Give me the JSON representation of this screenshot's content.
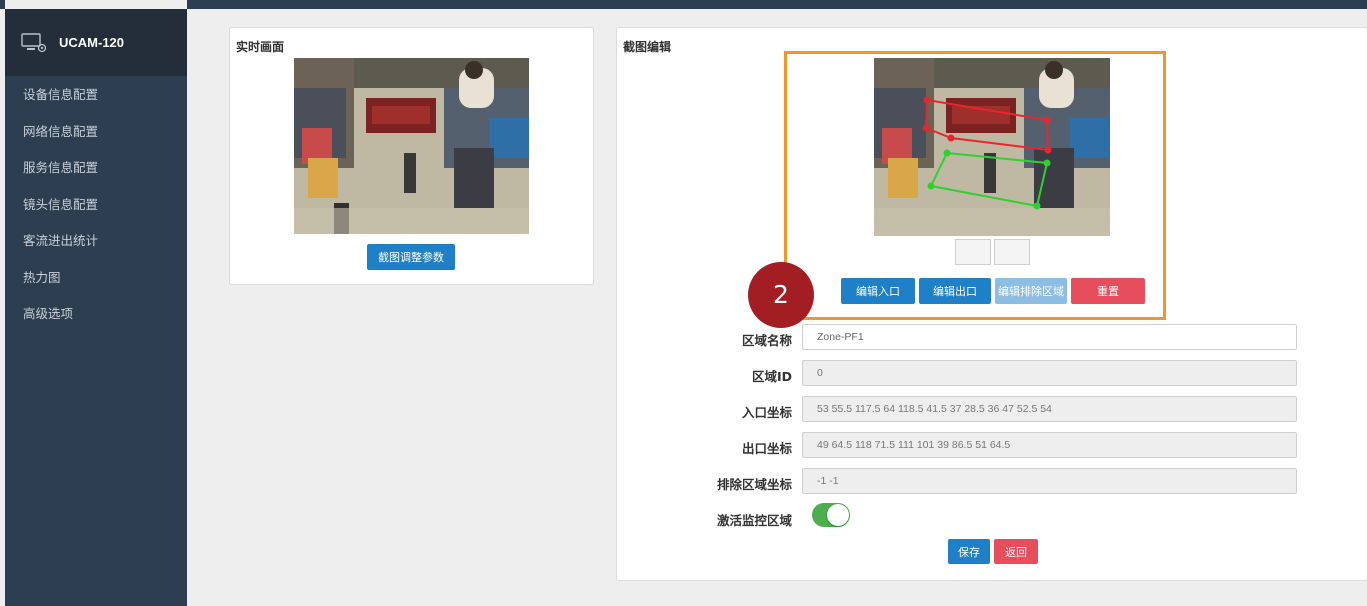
{
  "app": {
    "name": "UCAM-120"
  },
  "sidebar": {
    "items": [
      {
        "label": "设备信息配置"
      },
      {
        "label": "网络信息配置"
      },
      {
        "label": "服务信息配置"
      },
      {
        "label": "镜头信息配置"
      },
      {
        "label": "客流进出统计"
      },
      {
        "label": "热力图"
      },
      {
        "label": "高级选项"
      }
    ]
  },
  "live": {
    "title": "实时画面",
    "adjust_button": "截图调整参数"
  },
  "editor": {
    "title": "截图编辑",
    "buttons": {
      "edit_entry": "编辑入口",
      "edit_exit": "编辑出口",
      "edit_exclude": "编辑排除区域",
      "reset": "重置"
    },
    "badge": "2",
    "colors": {
      "entry_zone": "#e8262c",
      "exit_zone": "#2fd12f",
      "highlight_box": "#f0962e"
    }
  },
  "form": {
    "zone_name_label": "区域名称",
    "zone_name_value": "Zone-PF1",
    "zone_id_label": "区域ID",
    "zone_id_value": "0",
    "entry_coords_label": "入口坐标",
    "entry_coords_value": "53 55.5 117.5 64 118.5 41.5 37 28.5 36 47 52.5 54",
    "exit_coords_label": "出口坐标",
    "exit_coords_value": "49 64.5 118 71.5 111 101 39 86.5 51 64.5",
    "exclude_coords_label": "排除区域坐标",
    "exclude_coords_value": "-1 -1",
    "activate_label": "激活监控区域",
    "activate_on": true,
    "save_button": "保存",
    "back_button": "返回"
  }
}
